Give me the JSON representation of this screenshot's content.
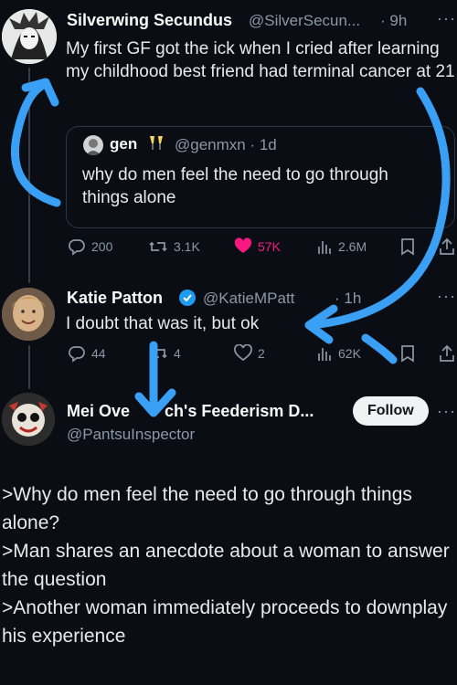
{
  "tweet1": {
    "name": "Silverwing Secundus",
    "handle": "@SilverSecun...",
    "time": "· 9h",
    "text": "My first GF got the ick when I cried after learning my childhood best friend had terminal cancer at 21",
    "quote": {
      "name": "gen",
      "handle": "@genmxn · 1d",
      "text": "why do men feel the need to go through things alone"
    },
    "actions": {
      "replies": "200",
      "retweets": "3.1K",
      "likes": "57K",
      "views": "2.6M"
    }
  },
  "tweet2": {
    "name": "Katie Patton",
    "handle": "@KatieMPatt",
    "time": "· 1h",
    "text": "I doubt that was it, but ok",
    "actions": {
      "replies": "44",
      "retweets": "4",
      "likes": "2",
      "views": "62K"
    }
  },
  "tweet3": {
    "name": "Mei Ove",
    "name_tail": "ch's Feederism D...",
    "handle": "@PantsuInspector",
    "follow_label": "Follow"
  },
  "caption": [
    ">Why do men feel the need to go through things alone?",
    ">Man shares an anecdote about a woman to answer the question",
    ">Another woman immediately proceeds to downplay his experience"
  ],
  "colors": {
    "background": "#0a0d14",
    "like_pink": "#f91880",
    "verified_blue": "#1d9bf0",
    "annotation_blue": "#3aa0f5"
  },
  "icons": [
    "reply-icon",
    "retweet-icon",
    "like-icon",
    "views-icon",
    "bookmark-icon",
    "share-icon",
    "verified-icon",
    "more-icon"
  ]
}
